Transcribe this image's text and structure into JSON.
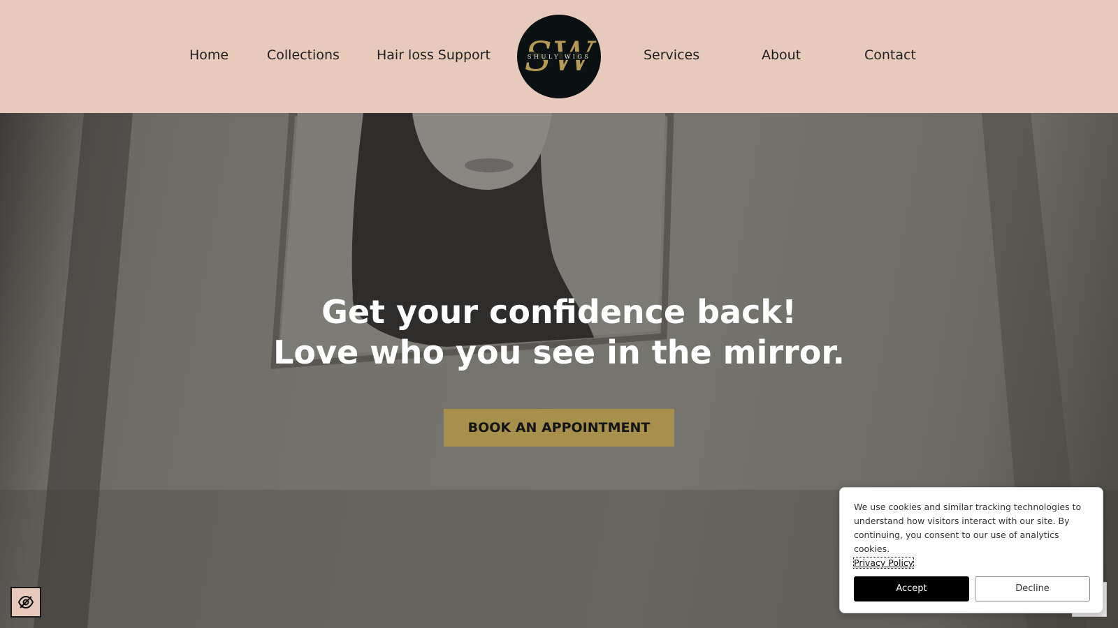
{
  "brand": {
    "logo_monogram": "SW",
    "logo_wordmark": "SHULY WIGS",
    "logo_bg": "#0b1012",
    "logo_gold": "#b49a55"
  },
  "nav": {
    "home": "Home",
    "collections": "Collections",
    "hair_loss": "Hair loss Support",
    "services": "Services",
    "about": "About",
    "contact": "Contact"
  },
  "hero": {
    "line1": "Get your confidence back!",
    "line2": "Love who you see in the mirror.",
    "cta": "BOOK AN APPOINTMENT"
  },
  "cookie": {
    "message": "We use cookies and similar tracking technologies to understand how visitors interact with our site. By continuing, you consent to our use of analytics cookies.",
    "policy_link": "Privacy Policy",
    "accept": "Accept",
    "decline": "Decline"
  },
  "accessibility": {
    "icon": "eye-slash-icon"
  },
  "colors": {
    "header_bg": "#e8cabd",
    "cta_bg": "#a7904c",
    "accept_bg": "#000000"
  }
}
